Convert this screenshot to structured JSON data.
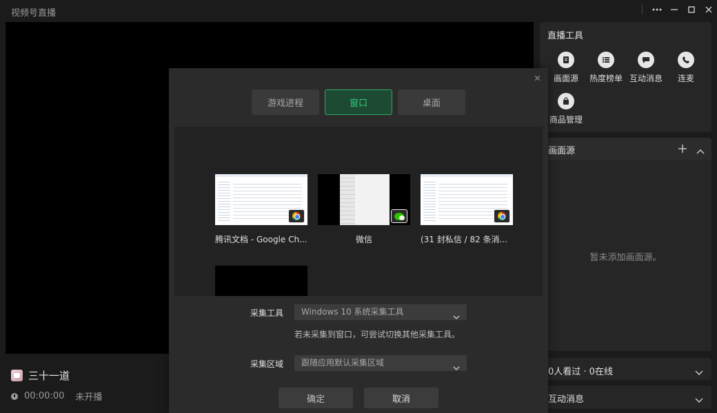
{
  "window": {
    "title": "视频号直播"
  },
  "streamer": {
    "name": "三十一道",
    "time": "00:00:00",
    "status": "未开播"
  },
  "tools": {
    "title": "直播工具",
    "items": [
      {
        "label": "画面源",
        "icon": "document-icon"
      },
      {
        "label": "热度榜单",
        "icon": "list-icon"
      },
      {
        "label": "互动消息",
        "icon": "chat-icon"
      },
      {
        "label": "连麦",
        "icon": "phone-icon"
      },
      {
        "label": "商品管理",
        "icon": "shopping-bag-icon"
      }
    ]
  },
  "sources": {
    "title": "画面源",
    "empty_text": "暂未添加画面源。"
  },
  "viewers": {
    "text": "0人看过 · 0在线"
  },
  "messages": {
    "title": "互动消息"
  },
  "dialog": {
    "tabs": [
      {
        "label": "游戏进程"
      },
      {
        "label": "窗口"
      },
      {
        "label": "桌面"
      }
    ],
    "windows": [
      {
        "title": "腾讯文档 - Google Ch..."
      },
      {
        "title": "微信"
      },
      {
        "title": "(31 封私信 / 82 条消..."
      }
    ],
    "capture_tool": {
      "label": "采集工具",
      "value": "Windows 10 系统采集工具",
      "hint": "若未采集到窗口，可尝试切换其他采集工具。"
    },
    "capture_area": {
      "label": "采集区域",
      "value": "跟随应用默认采集区域"
    },
    "buttons": {
      "ok": "确定",
      "cancel": "取消"
    }
  }
}
